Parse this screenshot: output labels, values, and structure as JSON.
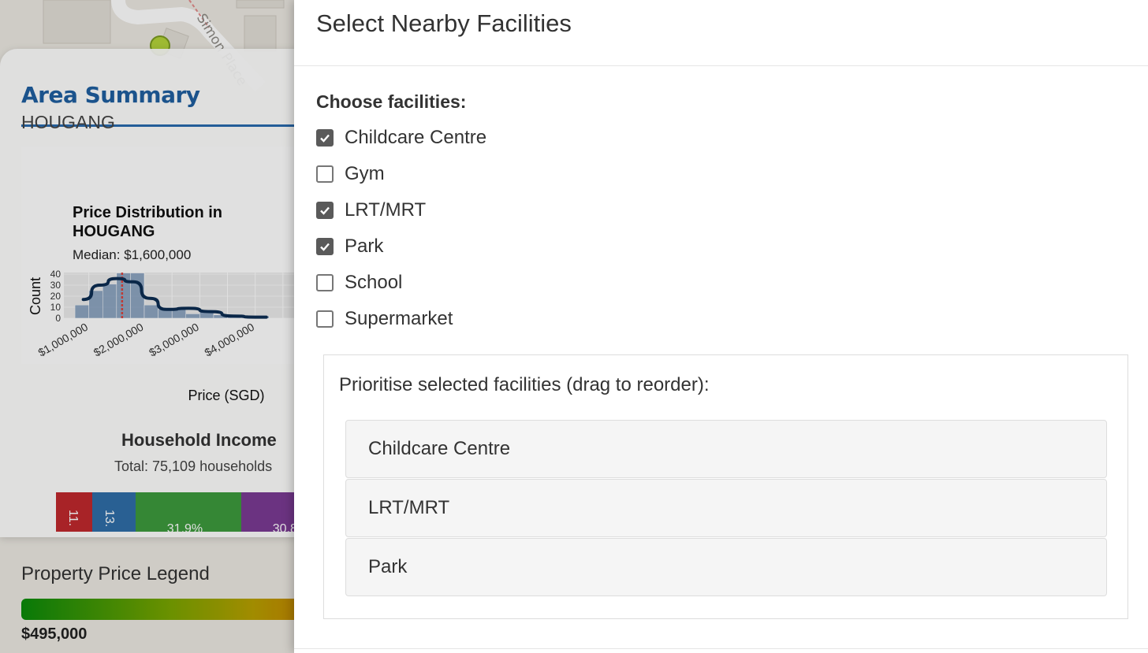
{
  "map": {
    "street_label": "Simon Place"
  },
  "summary": {
    "title": "Area Summary",
    "area": "HOUGANG",
    "price_chart": {
      "title": "Price Distribution in HOUGANG",
      "subtitle": "Median: $1,600,000",
      "xlabel": "Price (SGD)",
      "ylabel": "Count",
      "y_ticks": [
        "0",
        "10",
        "20",
        "30",
        "40"
      ],
      "x_ticks": [
        "$1,000,000",
        "$2,000,000",
        "$3,000,000",
        "$4,000,000"
      ]
    },
    "income": {
      "title": "Household Income",
      "subtitle": "Total: 75,109 households",
      "segments": [
        {
          "label": "11.",
          "color": "#c0282d",
          "percent": 11
        },
        {
          "label": "13.",
          "color": "#2f6ea8",
          "percent": 13
        },
        {
          "label": "31.9%",
          "color": "#3d9a3d",
          "percent": 31.9
        },
        {
          "label": "30.8",
          "color": "#7a3b93",
          "percent": 30.8
        }
      ]
    },
    "legend": {
      "title": "Property Price Legend",
      "min": "$495,000"
    }
  },
  "chart_data": {
    "type": "bar",
    "title": "Price Distribution in HOUGANG",
    "subtitle": "Median: $1,600,000",
    "xlabel": "Price (SGD)",
    "ylabel": "Count",
    "median": 1600000,
    "bin_edges": [
      750000,
      1000000,
      1250000,
      1500000,
      1750000,
      2000000,
      2250000,
      2500000,
      2750000,
      3000000,
      3250000,
      3500000,
      3750000,
      4000000,
      4250000
    ],
    "values": [
      12,
      25,
      31,
      41,
      41,
      12,
      8,
      8,
      4,
      6,
      3,
      2,
      2,
      2
    ],
    "ylim": [
      0,
      40
    ],
    "x_ticks": [
      1000000,
      2000000,
      3000000,
      4000000
    ],
    "density_curve": [
      [
        900000,
        17
      ],
      [
        1200000,
        30
      ],
      [
        1500000,
        36
      ],
      [
        1800000,
        33
      ],
      [
        2100000,
        18
      ],
      [
        2400000,
        8
      ],
      [
        2800000,
        9
      ],
      [
        3200000,
        6
      ],
      [
        3600000,
        2
      ],
      [
        4000000,
        1
      ],
      [
        4200000,
        1
      ]
    ],
    "grid": true
  },
  "modal": {
    "title": "Select Nearby Facilities",
    "choose_label": "Choose facilities:",
    "facilities": [
      {
        "label": "Childcare Centre",
        "checked": true
      },
      {
        "label": "Gym",
        "checked": false
      },
      {
        "label": "LRT/MRT",
        "checked": true
      },
      {
        "label": "Park",
        "checked": true
      },
      {
        "label": "School",
        "checked": false
      },
      {
        "label": "Supermarket",
        "checked": false
      }
    ],
    "priority_label": "Prioritise selected facilities (drag to reorder):",
    "priority_items": [
      "Childcare Centre",
      "LRT/MRT",
      "Park"
    ]
  }
}
